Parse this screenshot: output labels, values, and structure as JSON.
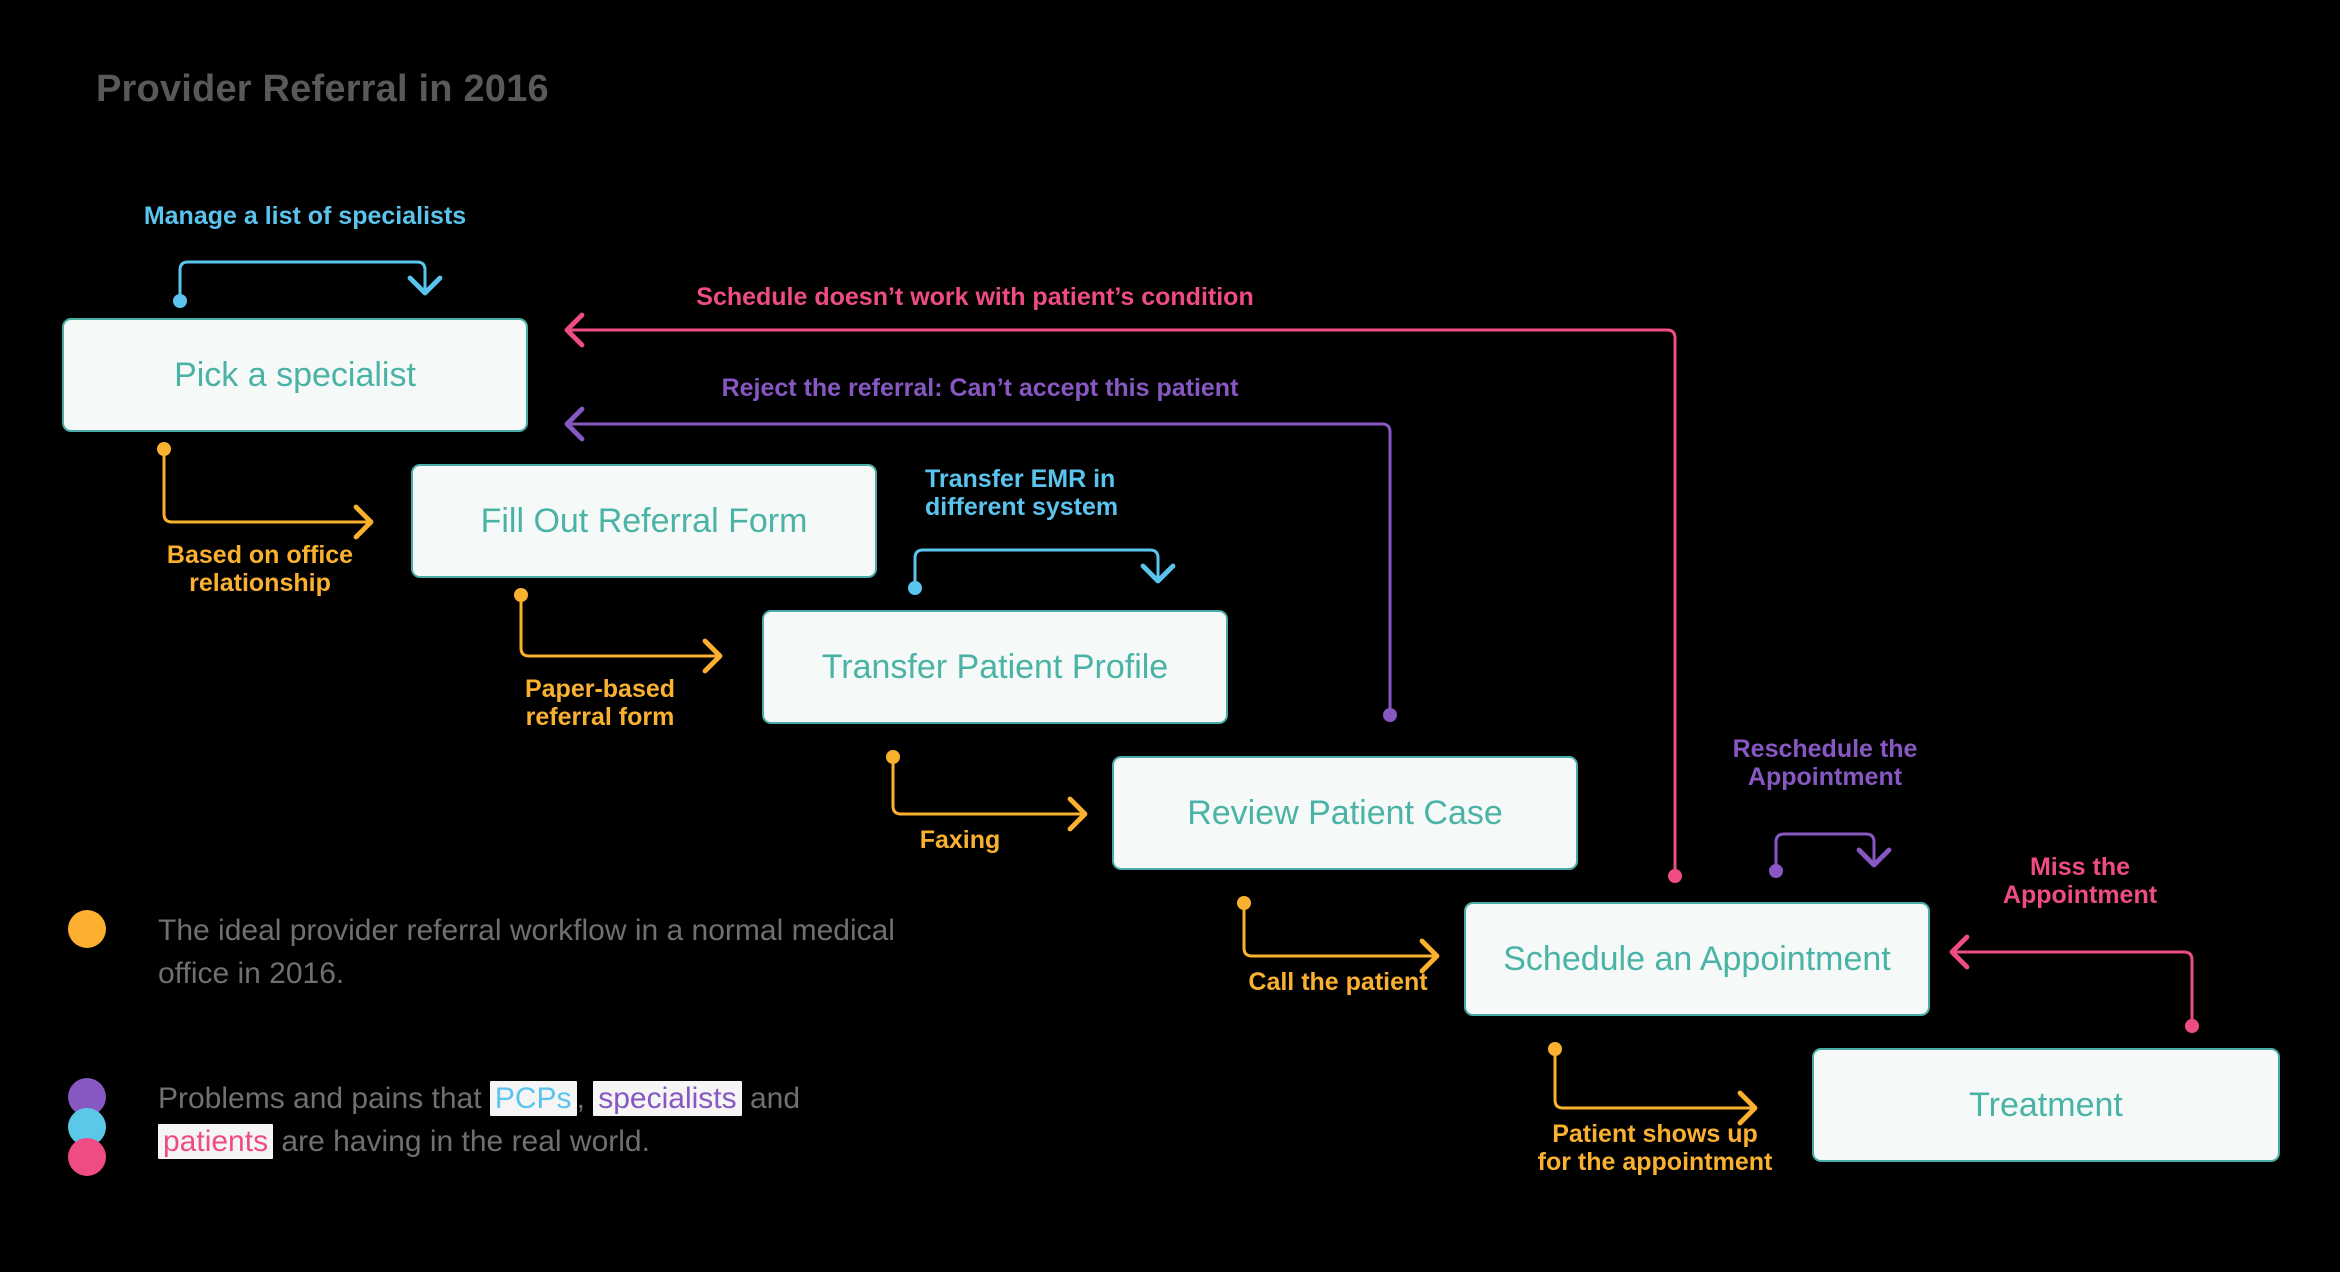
{
  "title": "Provider Referral in 2016",
  "colors": {
    "background": "#000000",
    "title_text": "#59595b",
    "node_fill": "#f5faf8",
    "node_border": "#4aaca4",
    "node_text": "#4bb3a6",
    "blue": "#5bc4ee",
    "yellow": "#fbb130",
    "pink": "#ef4b85",
    "purple": "#8757c2",
    "legend_text": "#6f7072"
  },
  "nodes": [
    {
      "id": "pick-a-specialist",
      "label": "Pick a specialist"
    },
    {
      "id": "fill-out-referral-form",
      "label": "Fill Out Referral Form"
    },
    {
      "id": "transfer-patient-profile",
      "label": "Transfer Patient Profile"
    },
    {
      "id": "review-patient-case",
      "label": "Review Patient Case"
    },
    {
      "id": "schedule-an-appointment",
      "label": "Schedule an Appointment"
    },
    {
      "id": "treatment",
      "label": "Treatment"
    }
  ],
  "edges": [
    {
      "id": "manage-list-of-specialists",
      "label": "Manage a list of specialists",
      "color": "blue"
    },
    {
      "id": "based-on-office-relationship",
      "label": "Based on office\nrelationship",
      "color": "yellow"
    },
    {
      "id": "paper-based-referral-form",
      "label": "Paper-based\nreferral form",
      "color": "yellow"
    },
    {
      "id": "transfer-emr",
      "label": "Transfer EMR in\ndifferent system",
      "color": "blue"
    },
    {
      "id": "faxing",
      "label": "Faxing",
      "color": "yellow"
    },
    {
      "id": "call-the-patient",
      "label": "Call the patient",
      "color": "yellow"
    },
    {
      "id": "patient-shows-up",
      "label": "Patient shows up\nfor the appointment",
      "color": "yellow"
    },
    {
      "id": "schedule-doesnt-work",
      "label": "Schedule doesn’t work with patient’s condition",
      "color": "pink"
    },
    {
      "id": "reject-the-referral",
      "label": "Reject the referral: Can’t accept this patient",
      "color": "purple"
    },
    {
      "id": "reschedule-the-appointment",
      "label": "Reschedule the\nAppointment",
      "color": "purple"
    },
    {
      "id": "miss-the-appointment",
      "label": "Miss the\nAppointment",
      "color": "pink"
    }
  ],
  "legend": [
    {
      "id": "ideal-workflow",
      "dots": [
        "orange"
      ],
      "text": "The ideal provider referral workflow in a normal medical office in 2016."
    },
    {
      "id": "problems-and-pains",
      "dots": [
        "purple",
        "blue",
        "pink"
      ],
      "segments": [
        {
          "text": "Problems and pains that ",
          "style": "plain"
        },
        {
          "text": "PCPs",
          "style": "pcp"
        },
        {
          "text": ", ",
          "style": "plain"
        },
        {
          "text": "specialists",
          "style": "spec"
        },
        {
          "text": " and ",
          "style": "plain"
        },
        {
          "text": "patients",
          "style": "pat"
        },
        {
          "text": " are having in the real world.",
          "style": "plain"
        }
      ]
    }
  ],
  "chart_data": {
    "type": "diagram",
    "title": "Provider Referral in 2016",
    "flow": [
      {
        "from": "Pick a specialist",
        "to": "Fill Out Referral Form",
        "label": "Based on office relationship",
        "color": "yellow"
      },
      {
        "from": "Fill Out Referral Form",
        "to": "Transfer Patient Profile",
        "label": "Paper-based referral form",
        "color": "yellow"
      },
      {
        "from": "Transfer Patient Profile",
        "to": "Review Patient Case",
        "label": "Faxing",
        "color": "yellow"
      },
      {
        "from": "Review Patient Case",
        "to": "Schedule an Appointment",
        "label": "Call the patient",
        "color": "yellow"
      },
      {
        "from": "Schedule an Appointment",
        "to": "Treatment",
        "label": "Patient shows up for the appointment",
        "color": "yellow"
      },
      {
        "from": "Pick a specialist",
        "to": "Pick a specialist",
        "label": "Manage a list of specialists",
        "color": "blue"
      },
      {
        "from": "Fill Out Referral Form",
        "to": "Transfer Patient Profile",
        "label": "Transfer EMR in different system",
        "color": "blue"
      },
      {
        "from": "Schedule an Appointment",
        "to": "Pick a specialist",
        "label": "Schedule doesn’t work with patient’s condition",
        "color": "pink"
      },
      {
        "from": "Review Patient Case",
        "to": "Pick a specialist",
        "label": "Reject the referral: Can’t accept this patient",
        "color": "purple"
      },
      {
        "from": "Schedule an Appointment",
        "to": "Schedule an Appointment",
        "label": "Reschedule the Appointment",
        "color": "purple"
      },
      {
        "from": "Treatment",
        "to": "Schedule an Appointment",
        "label": "Miss the Appointment",
        "color": "pink"
      }
    ]
  }
}
